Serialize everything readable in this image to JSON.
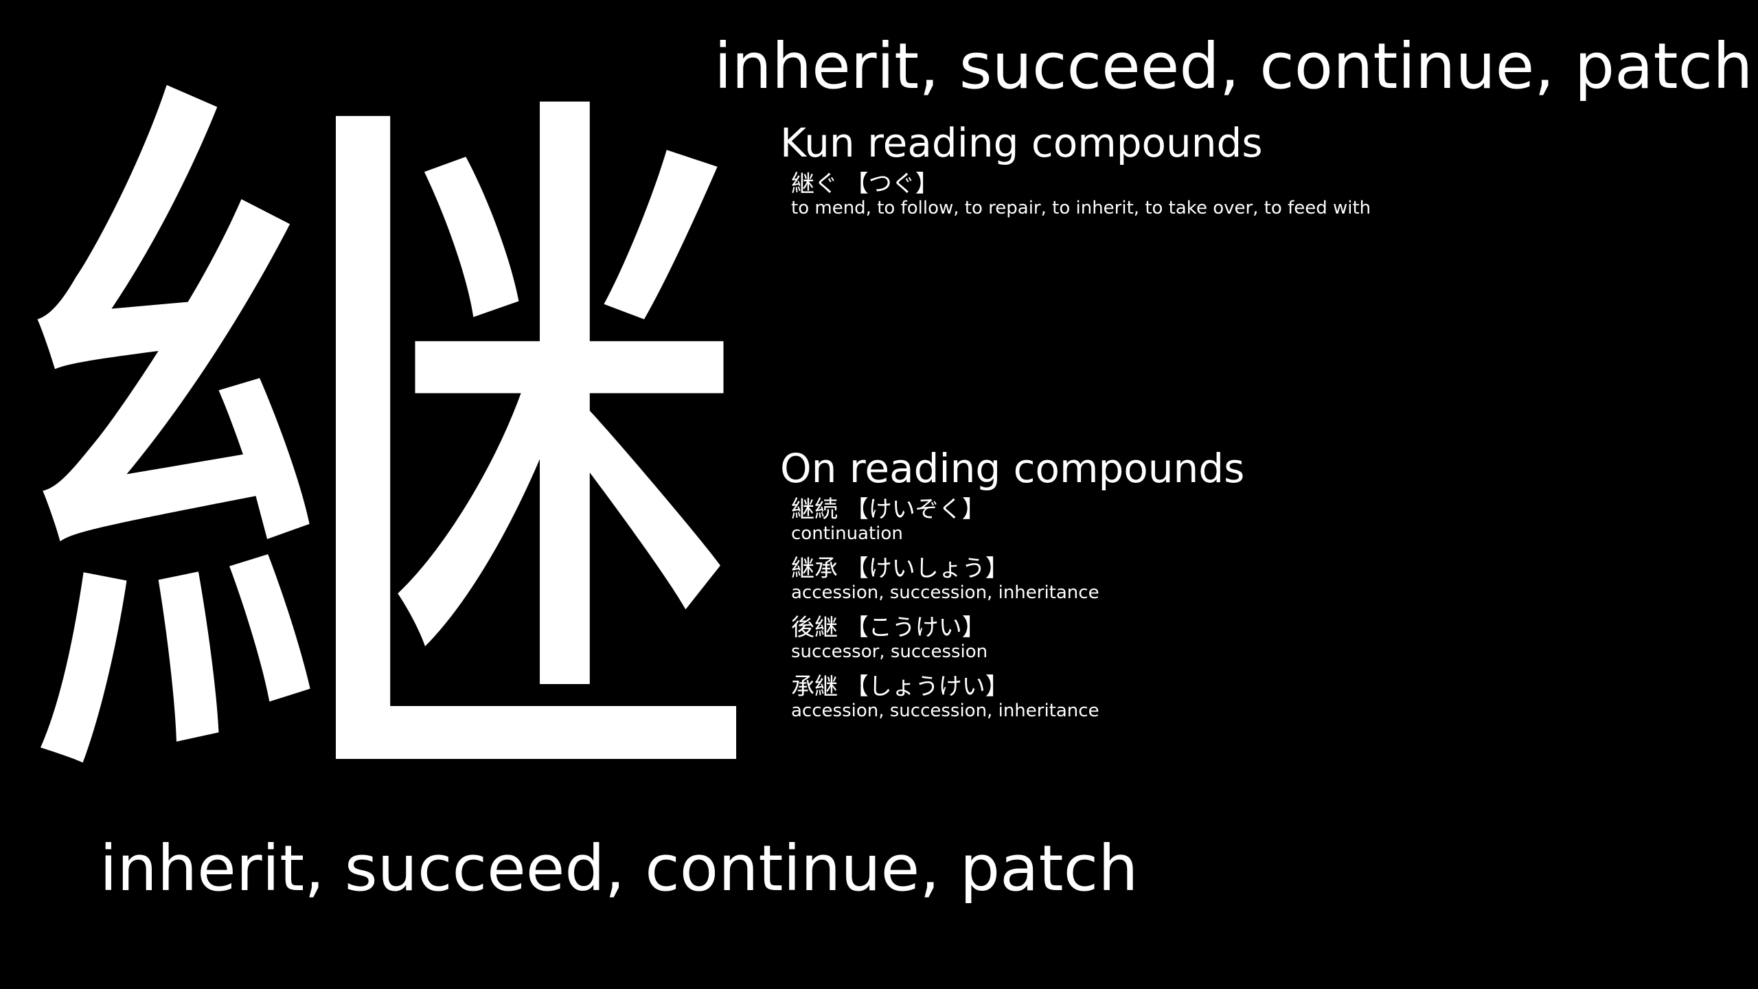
{
  "kanji": "継",
  "meaning_top": "inherit, succeed, continue, patch",
  "meaning_bottom": "inherit, succeed, continue, patch",
  "kun": {
    "title": "Kun reading compounds",
    "entries": [
      {
        "word": "継ぐ 【つぐ】",
        "gloss": "to mend, to follow, to repair, to inherit, to take over, to feed with"
      }
    ]
  },
  "on": {
    "title": "On reading compounds",
    "entries": [
      {
        "word": "継続 【けいぞく】",
        "gloss": "continuation"
      },
      {
        "word": "継承 【けいしょう】",
        "gloss": "accession, succession, inheritance"
      },
      {
        "word": "後継 【こうけい】",
        "gloss": "successor, succession"
      },
      {
        "word": "承継 【しょうけい】",
        "gloss": "accession, succession, inheritance"
      }
    ]
  }
}
